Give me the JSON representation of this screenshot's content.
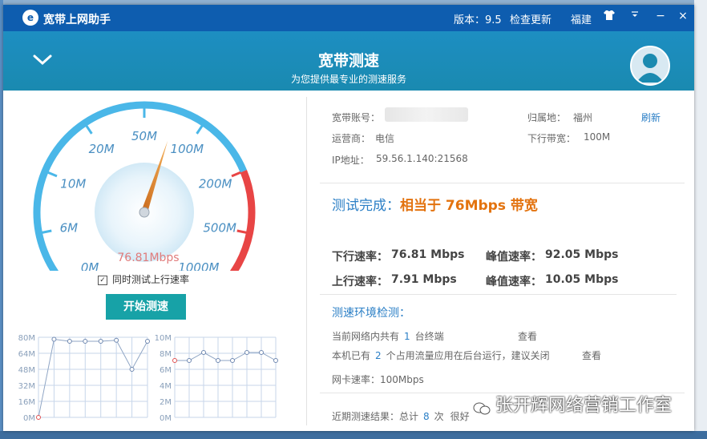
{
  "titlebar": {
    "app_name": "宽带上网助手",
    "version": "版本：9.5",
    "check_update": "检查更新",
    "region": "福建",
    "minimize": "−",
    "close": "×"
  },
  "header": {
    "title": "宽带测速",
    "subtitle": "为您提供最专业的测速服务"
  },
  "gauge": {
    "scale_labels": [
      "0M",
      "6M",
      "10M",
      "20M",
      "50M",
      "100M",
      "200M",
      "500M",
      "1000M"
    ],
    "reading": "76.81Mbps",
    "colors": {
      "arc": "#4ab7e8",
      "danger": "#e84545",
      "needle": "#e08a1e"
    }
  },
  "controls": {
    "upload_test_label": "同时测试上行速率",
    "upload_test_checked": true,
    "start_button": "开始测速"
  },
  "mini_charts": {
    "left": {
      "y_ticks": [
        "80M",
        "64M",
        "48M",
        "32M",
        "16M",
        "0M"
      ],
      "values": [
        0,
        78,
        76,
        76,
        76,
        77,
        48,
        76
      ]
    },
    "right": {
      "y_ticks": [
        "10M",
        "8M",
        "6M",
        "4M",
        "2M",
        "0M"
      ],
      "values": [
        7.1,
        7.1,
        8.1,
        7.1,
        7.1,
        8.1,
        8.1,
        7.1
      ]
    }
  },
  "info": {
    "account_label": "宽带账号：",
    "location_label": "归属地：",
    "location_value": "福州",
    "refresh": "刷新",
    "isp_label": "运营商：",
    "isp_value": "电信",
    "downlink_label": "下行带宽：",
    "downlink_value": "100M",
    "ip_label": "IP地址：",
    "ip_value": "59.56.1.140:21568"
  },
  "result": {
    "prefix": "测试完成：",
    "value": "相当于 76Mbps 带宽"
  },
  "speeds": {
    "down_label": "下行速率：",
    "down_value": "76.81 Mbps",
    "peak_down_label": "峰值速率：",
    "peak_down_value": "92.05 Mbps",
    "up_label": "上行速率：",
    "up_value": "7.91 Mbps",
    "peak_up_label": "峰值速率：",
    "peak_up_value": "10.05 Mbps"
  },
  "environment": {
    "title": "测速环境检测：",
    "network_prefix": "当前网络内共有",
    "network_count": "1",
    "network_suffix": "台终端",
    "view1": "查看",
    "apps_prefix": "本机已有",
    "apps_count": "2",
    "apps_suffix": "个占用流量应用在后台运行，建议关闭",
    "view2": "查看",
    "nic_label": "网卡速率：",
    "nic_value": "100Mbps"
  },
  "recent": {
    "prefix": "近期测速结果：总计",
    "count": "8",
    "unit": "次",
    "trailing": "很好"
  },
  "watermark": "张开辉网络营销工作室"
}
